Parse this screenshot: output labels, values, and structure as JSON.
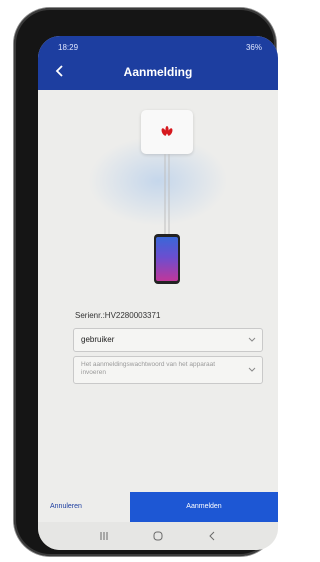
{
  "status_bar": {
    "time": "18:29",
    "battery": "36%"
  },
  "header": {
    "title": "Aanmelding",
    "back_icon": "arrow-left-icon"
  },
  "device": {
    "serial_label": "Serienr.:HV2280003371"
  },
  "form": {
    "user_value": "gebruiker",
    "password_placeholder": "Het aanmeldingswachtwoord van het apparaat invoeren"
  },
  "actions": {
    "cancel_label": "Annuleren",
    "login_label": "Aanmelden"
  },
  "colors": {
    "header_bg": "#1d3ea0",
    "primary_button": "#1d57d4",
    "brand_red": "#d6181e"
  }
}
